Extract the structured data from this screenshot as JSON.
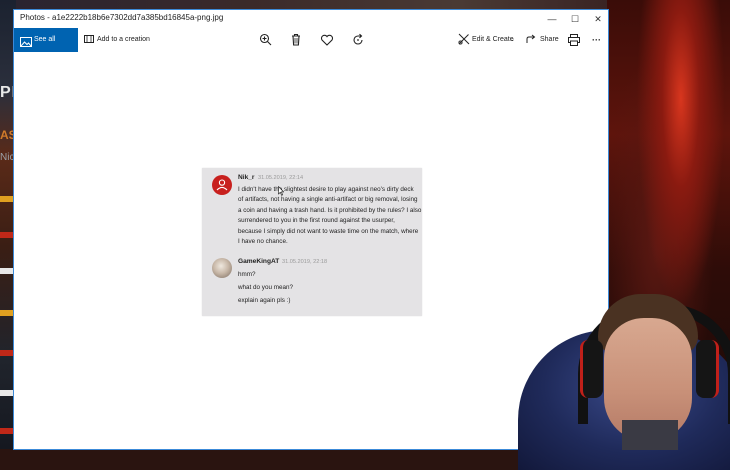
{
  "window": {
    "title": "Photos - a1e2222b18b6e7302dd7a385bd16845a-png.jpg",
    "minimize_glyph": "—",
    "maximize_glyph": "☐",
    "close_glyph": "✕"
  },
  "toolbar": {
    "see_all_photos": "See all photos",
    "add_to_creation": "Add to a creation",
    "edit_create": "Edit & Create",
    "share": "Share",
    "more_glyph": "···"
  },
  "chat": {
    "messages": [
      {
        "author": "Nik_r",
        "time": "31.05.2019, 22:14",
        "lines": [
          "I didn't have the slightest desire to play against neo's dirty deck",
          "of artifacts, not having a single anti-artifact or big removal, losing",
          "a coin and having a trash hand. Is it prohibited by the rules? I also",
          "surrendered to you in the first round against the usurper,",
          "because I simply did not want to waste time on the match, where",
          "I have no chance."
        ]
      },
      {
        "author": "GameKingAT",
        "time": "31.05.2019, 22:18",
        "lines": [
          "hmm?",
          "what do you mean?",
          "explain again pls :)"
        ]
      }
    ]
  },
  "background": {
    "left_text_1": "PR",
    "left_text_2": "ASC",
    "left_text_3": "Nic"
  },
  "colors": {
    "accent": "#0063b1",
    "avatar1": "#c8201e",
    "chat_bg": "#e4e3e5"
  }
}
